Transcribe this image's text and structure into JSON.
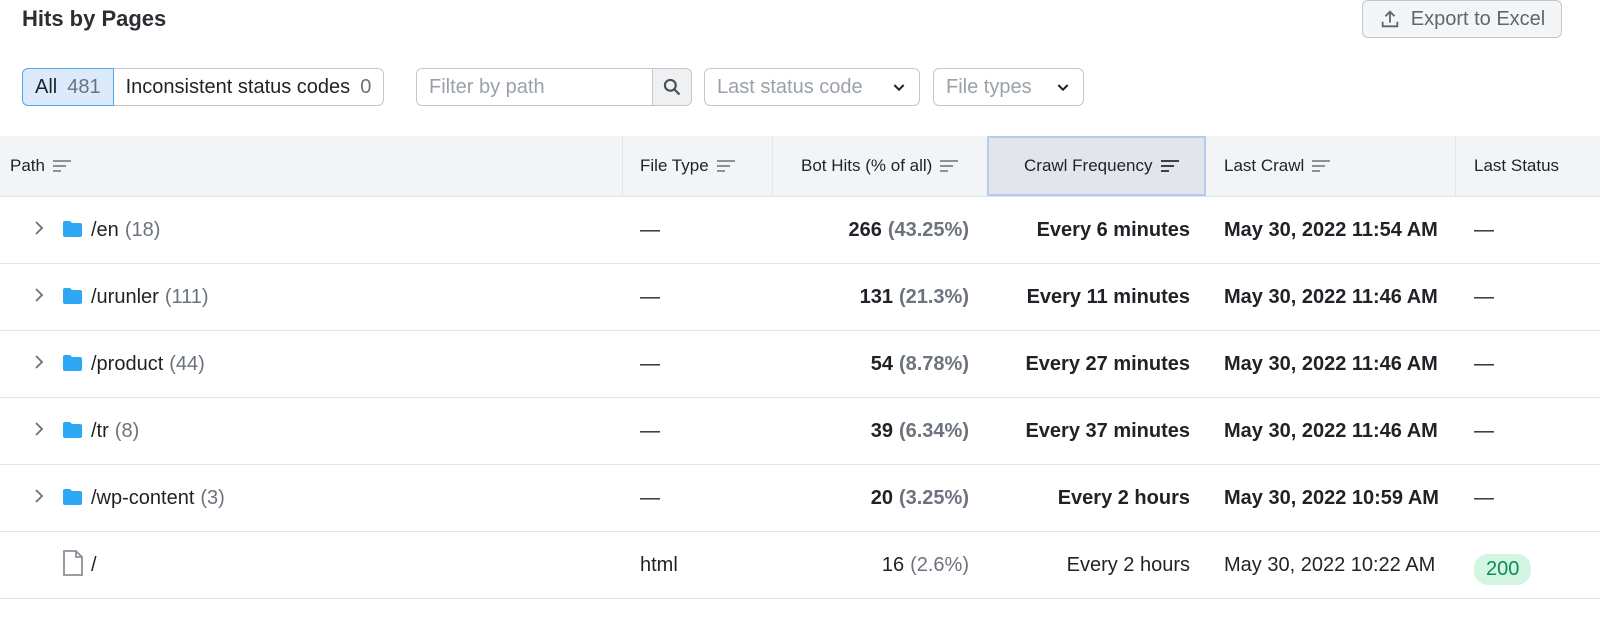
{
  "header": {
    "title": "Hits by Pages",
    "export_label": "Export to Excel"
  },
  "filters": {
    "all_label": "All",
    "all_count": "481",
    "inconsistent_label": "Inconsistent status codes",
    "inconsistent_count": "0",
    "path_placeholder": "Filter by path",
    "status_dropdown": "Last status code",
    "filetype_dropdown": "File types"
  },
  "columns": {
    "path": "Path",
    "file_type": "File Type",
    "bot_hits": "Bot Hits (% of all)",
    "crawl_frequency": "Crawl Frequency",
    "last_crawl": "Last Crawl",
    "last_status": "Last Status"
  },
  "rows": [
    {
      "path": "/en",
      "count": "(18)",
      "file_type": "—",
      "hits": "266",
      "pct": "(43.25%)",
      "freq": "Every 6 minutes",
      "last_crawl": "May 30, 2022 11:54 AM",
      "status": "—"
    },
    {
      "path": "/urunler",
      "count": "(111)",
      "file_type": "—",
      "hits": "131",
      "pct": "(21.3%)",
      "freq": "Every 11 minutes",
      "last_crawl": "May 30, 2022 11:46 AM",
      "status": "—"
    },
    {
      "path": "/product",
      "count": "(44)",
      "file_type": "—",
      "hits": "54",
      "pct": "(8.78%)",
      "freq": "Every 27 minutes",
      "last_crawl": "May 30, 2022 11:46 AM",
      "status": "—"
    },
    {
      "path": "/tr",
      "count": "(8)",
      "file_type": "—",
      "hits": "39",
      "pct": "(6.34%)",
      "freq": "Every 37 minutes",
      "last_crawl": "May 30, 2022 11:46 AM",
      "status": "—"
    },
    {
      "path": "/wp-content",
      "count": "(3)",
      "file_type": "—",
      "hits": "20",
      "pct": "(3.25%)",
      "freq": "Every 2 hours",
      "last_crawl": "May 30, 2022 10:59 AM",
      "status": "—"
    },
    {
      "path": "/",
      "file_type": "html",
      "hits": "16",
      "pct": "(2.6%)",
      "freq": "Every 2 hours",
      "last_crawl": "May 30, 2022 10:22 AM",
      "status": "200"
    }
  ],
  "icons": {
    "export": "upload-icon",
    "search": "search-icon",
    "folder": "folder-icon",
    "file": "file-icon",
    "chevron": "chevron-right-icon",
    "sort": "sort-icon"
  },
  "colors": {
    "folder": "#2ea8f5",
    "active_tab": "#dcebfb",
    "status_ok_bg": "#d3f6e3",
    "status_ok_text": "#0d8a56"
  }
}
